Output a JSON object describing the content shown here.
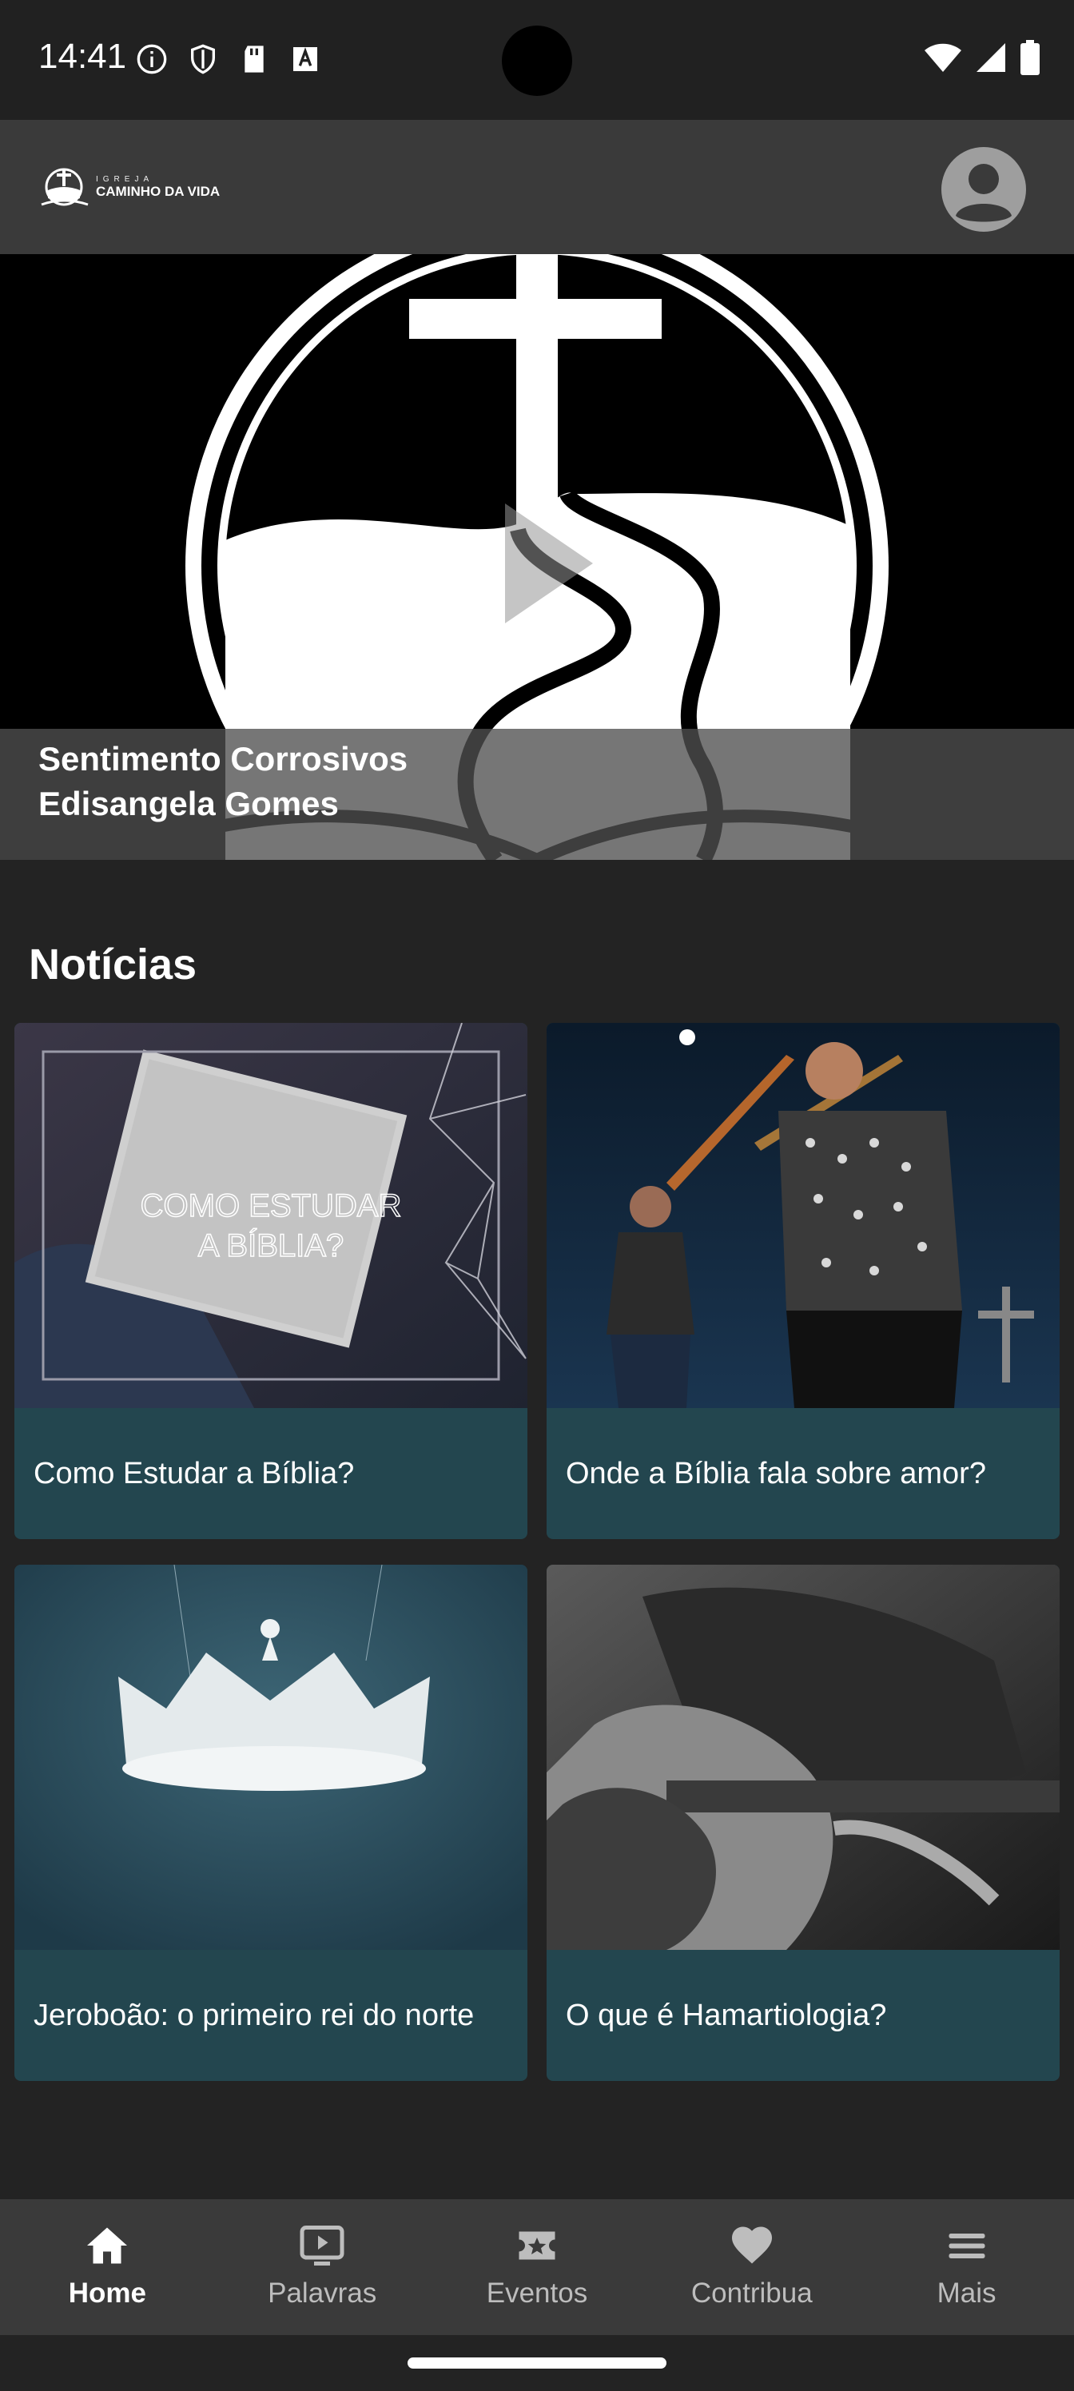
{
  "status_bar": {
    "time": "14:41"
  },
  "app_bar": {
    "logo_small": "IGREJA",
    "logo_main": "CAMINHO DA VIDA"
  },
  "hero": {
    "title": "Sentimento Corrosivos",
    "subtitle": "Edisangela Gomes"
  },
  "news": {
    "section_title": "Notícias",
    "cards": [
      {
        "title": "Como Estudar a Bíblia?",
        "image_text_1": "COMO ESTUDAR",
        "image_text_2": "A BÍBLIA?"
      },
      {
        "title": "Onde a Bíblia fala sobre amor?"
      },
      {
        "title": "Jeroboão: o primeiro rei do norte"
      },
      {
        "title": "O que é Hamartiologia?"
      }
    ]
  },
  "bottom_nav": {
    "items": [
      {
        "label": "Home",
        "icon": "home-icon",
        "active": true
      },
      {
        "label": "Palavras",
        "icon": "video-icon",
        "active": false
      },
      {
        "label": "Eventos",
        "icon": "events-star-icon",
        "active": false
      },
      {
        "label": "Contribua",
        "icon": "heart-icon",
        "active": false
      },
      {
        "label": "Mais",
        "icon": "menu-icon",
        "active": false
      }
    ]
  },
  "colors": {
    "card_bg": "#23464f",
    "app_bar": "#3a3a3a",
    "background": "#232323"
  }
}
